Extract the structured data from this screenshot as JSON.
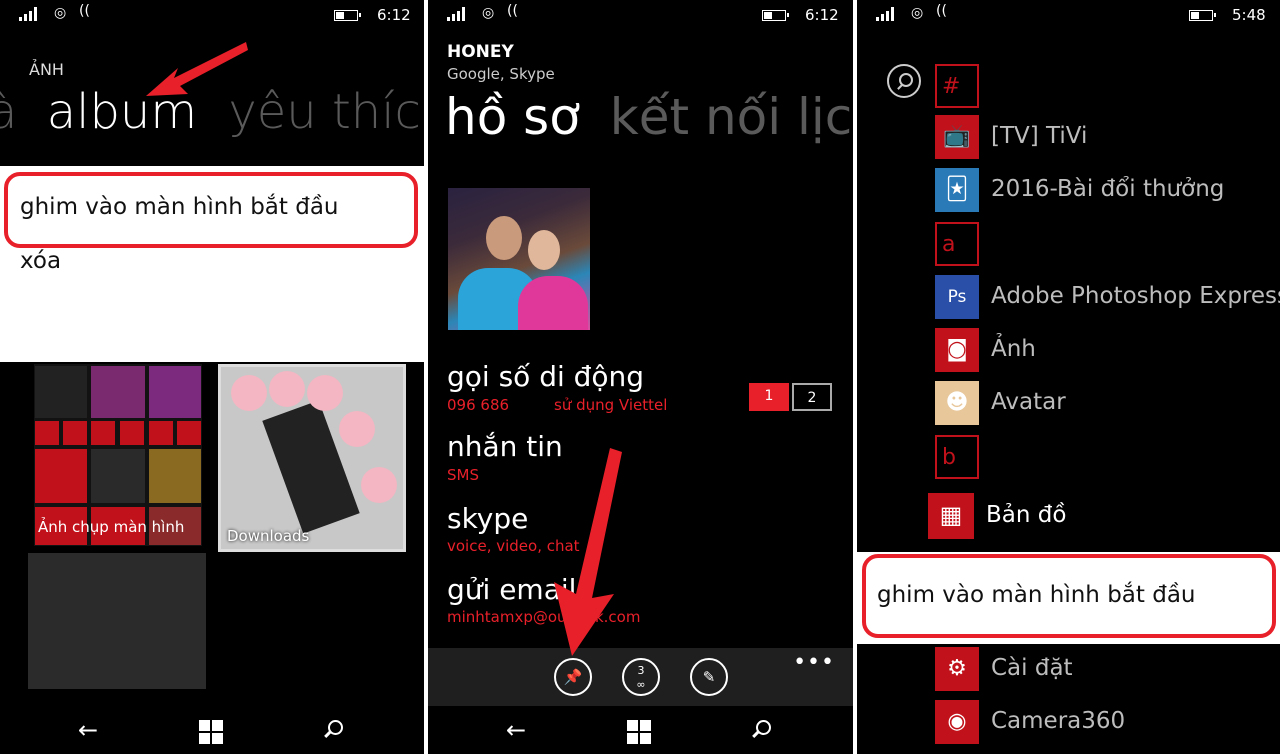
{
  "panel1": {
    "time": "6:12",
    "section_title": "ẢNH",
    "pivot": {
      "left_fragment": "à",
      "current": "album",
      "next": "yêu thích"
    },
    "context_menu": [
      "ghim vào màn hình bắt đầu",
      "xóa"
    ],
    "album_screenshots_label": "Ảnh chụp màn hình",
    "album_downloads_label": "Downloads"
  },
  "panel2": {
    "time": "6:12",
    "contact_name": "HONEY",
    "contact_sources": "Google, Skype",
    "pivot": {
      "current": "hồ sơ",
      "next": "kết nối lịch"
    },
    "actions": [
      {
        "title": "gọi số di động",
        "sub": "096 686",
        "sub2": "sử dụng Viettel"
      },
      {
        "title": "nhắn tin",
        "sub": "SMS"
      },
      {
        "title": "skype",
        "sub": "voice, video, chat"
      },
      {
        "title": "gửi email",
        "sub": "minhtamxp@outlook.com"
      }
    ],
    "sim_buttons": [
      "1",
      "2"
    ],
    "appbar": {
      "link_count": "3",
      "more": "•••"
    }
  },
  "panel3": {
    "time": "5:48",
    "letters": [
      "#",
      "a",
      "b"
    ],
    "apps": [
      {
        "name": "[TV] TiVi",
        "icon": "tv-icon"
      },
      {
        "name": "2016-Bài đổi thưởng",
        "icon": "game-icon"
      },
      {
        "name": "Adobe Photoshop Express",
        "icon": "photoshop-icon",
        "glyph": "Ps"
      },
      {
        "name": "Ảnh",
        "icon": "camera-icon"
      },
      {
        "name": "Avatar",
        "icon": "avatar-icon"
      },
      {
        "name": "Bản đồ",
        "icon": "maps-icon"
      },
      {
        "name": "Cài đặt",
        "icon": "settings-icon"
      },
      {
        "name": "Camera360",
        "icon": "camera360-icon"
      }
    ],
    "context_menu": [
      "ghim vào màn hình bắt đầu"
    ]
  },
  "colors": {
    "accent": "#c1121b",
    "highlight": "#e8202a",
    "appbar": "#1f1f1f"
  }
}
